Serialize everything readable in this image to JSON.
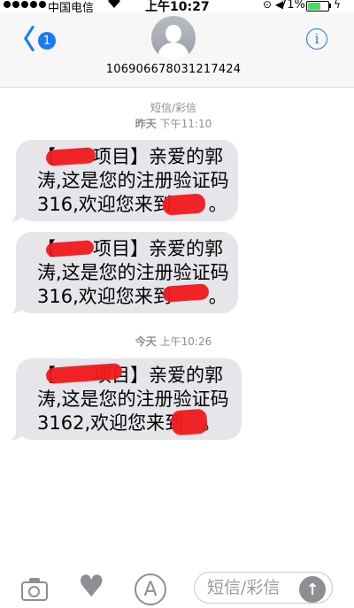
{
  "status_bar": {
    "carrier": "中国电信",
    "wifi_icon": "wifi-icon",
    "time": "上午10:27",
    "icons": "⊙ ◀",
    "battery_percent": "71%",
    "battery_level": 0.71,
    "charging_icon": "ϟ"
  },
  "nav": {
    "back_chevron": "〈",
    "unread_count": "1",
    "contact": "106906678031217424",
    "info_glyph": "i"
  },
  "thread": {
    "service_label": "短信/彩信",
    "groups": [
      {
        "day": "昨天",
        "time": "下午11:10",
        "messages": [
          {
            "lines": [
              "【　　项目】亲爱的郭",
              "涛,这是您的注册验证码",
              "316,欢迎您来到　　。"
            ]
          },
          {
            "lines": [
              "【　　项目】亲爱的郭",
              "涛,这是您的注册验证码",
              "316,欢迎您来到　　。"
            ]
          }
        ]
      },
      {
        "day": "今天",
        "time": "上午10:26",
        "messages": [
          {
            "lines": [
              "【　　项目】亲爱的郭",
              "涛,这是您的注册验证码",
              "3162,欢迎您来到　。"
            ]
          }
        ]
      }
    ]
  },
  "composer": {
    "placeholder": "短信/彩信",
    "send_glyph": "↑",
    "appstore_glyph": "A",
    "heart_glyph": "♥"
  },
  "colors": {
    "accent": "#1a7bf5",
    "bubble": "#e5e5ea",
    "redaction": "#f0191c"
  }
}
